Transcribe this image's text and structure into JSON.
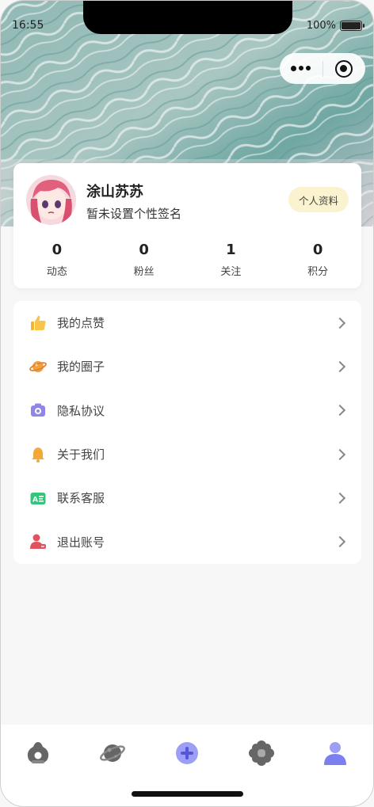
{
  "status": {
    "time": "16:55",
    "battery": "100%"
  },
  "profile": {
    "name": "涂山苏苏",
    "bio": "暂未设置个性签名",
    "button": "个人资料"
  },
  "stats": [
    {
      "value": "0",
      "label": "动态"
    },
    {
      "value": "0",
      "label": "粉丝"
    },
    {
      "value": "1",
      "label": "关注"
    },
    {
      "value": "0",
      "label": "积分"
    }
  ],
  "menu": [
    {
      "label": "我的点赞",
      "icon": "thumbs-up-icon"
    },
    {
      "label": "我的圈子",
      "icon": "planet-icon"
    },
    {
      "label": "隐私协议",
      "icon": "camera-icon"
    },
    {
      "label": "关于我们",
      "icon": "bell-icon"
    },
    {
      "label": "联系客服",
      "icon": "support-card-icon"
    },
    {
      "label": "退出账号",
      "icon": "logout-user-icon"
    }
  ],
  "tabbar": [
    "home-icon",
    "planet-icon",
    "add-icon",
    "flower-icon",
    "user-icon"
  ],
  "colors": {
    "accent": "#7b7ff0",
    "badge_bg": "#fbf3cf",
    "thumb": "#f5b431",
    "planet": "#f0a23a",
    "camera": "#8f86e8",
    "bell": "#f3a83a",
    "support": "#34c47c",
    "logout": "#e0525d"
  }
}
